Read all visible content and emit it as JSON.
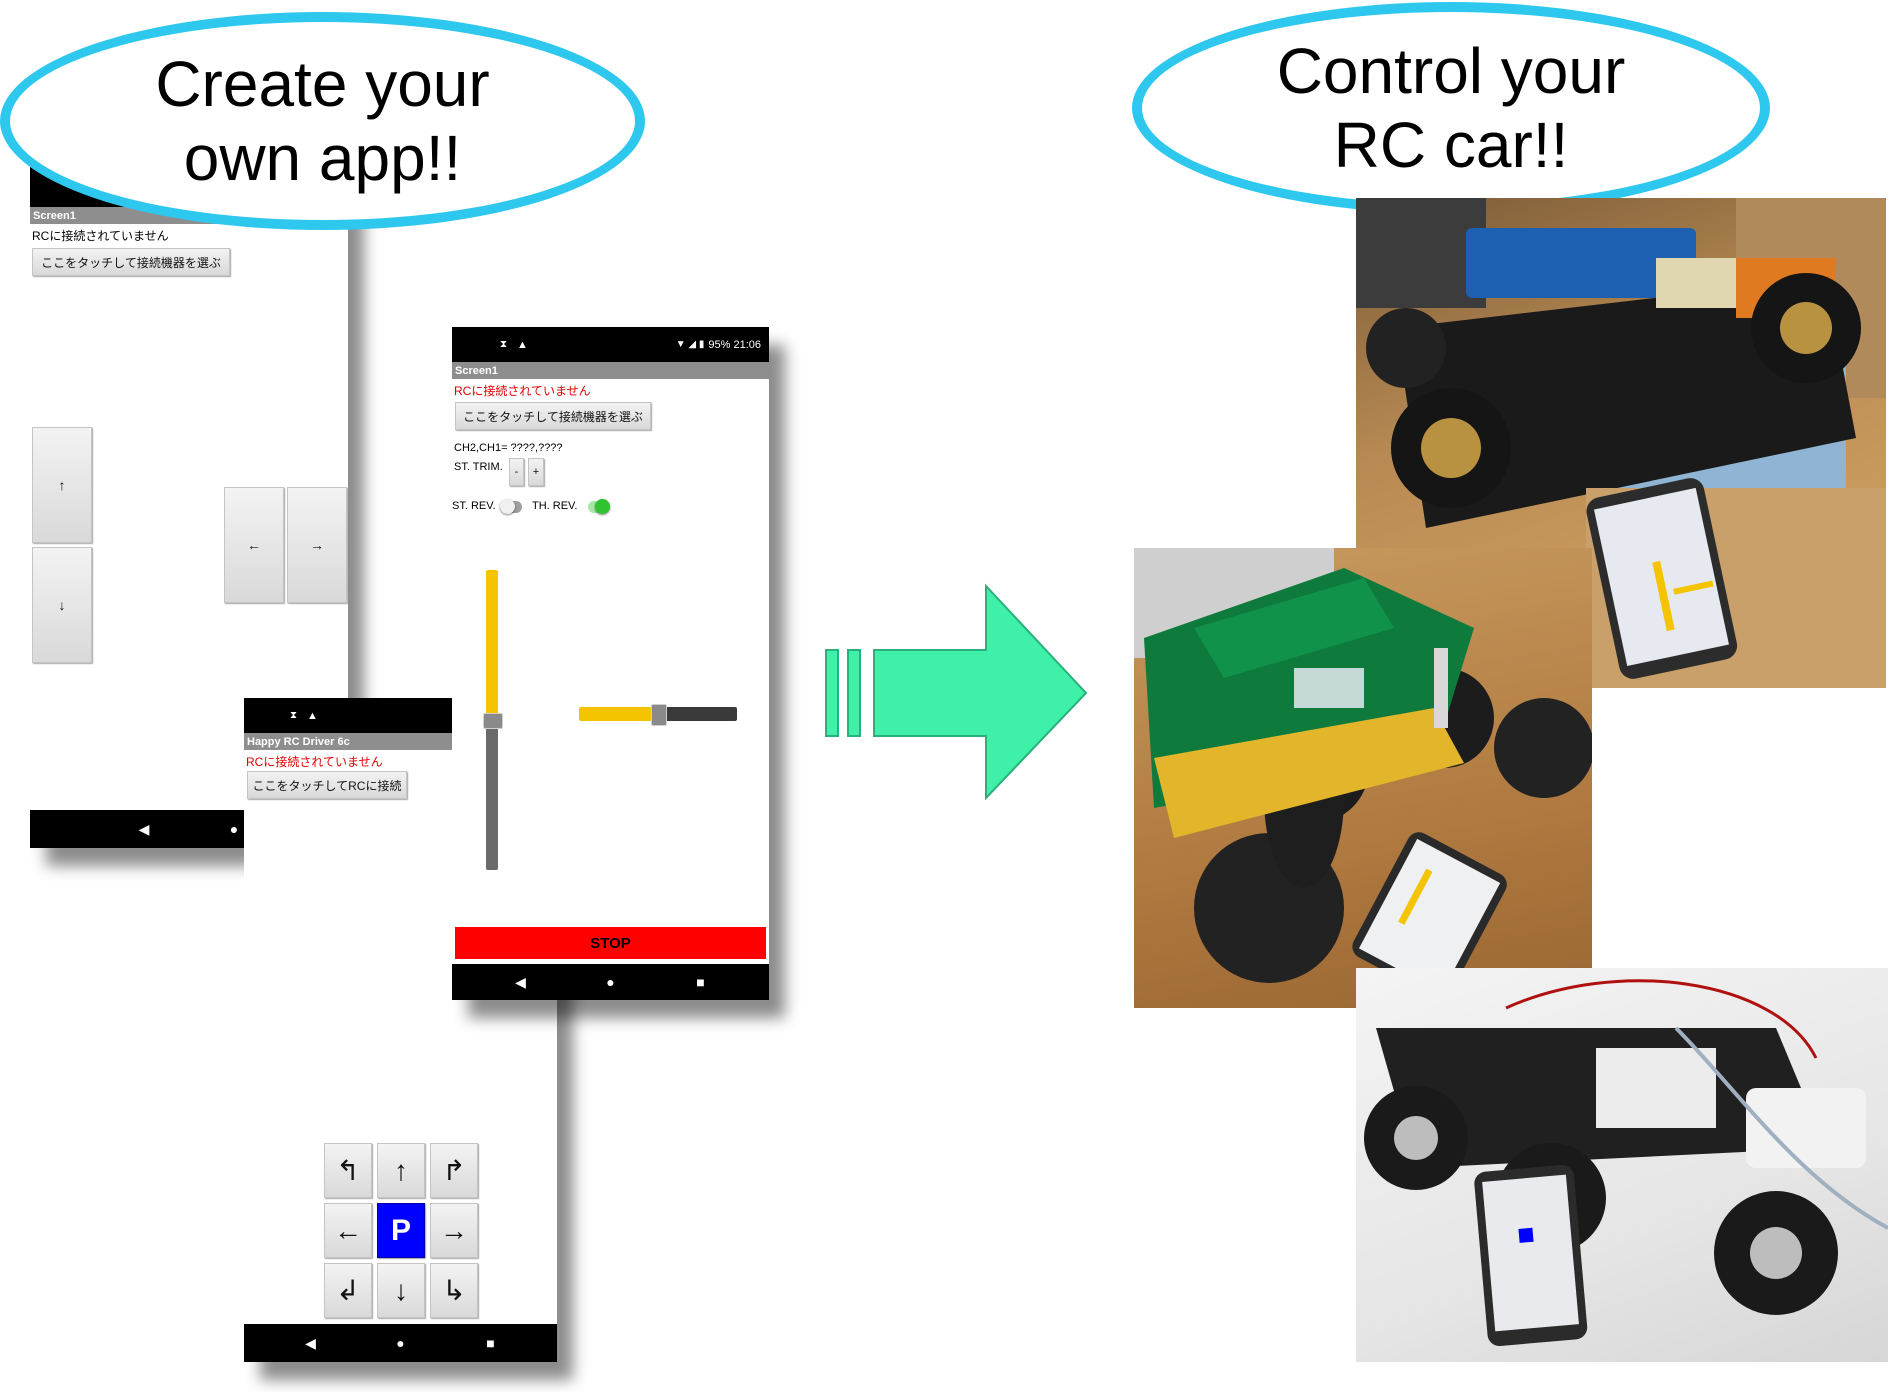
{
  "callout_left": {
    "line1": "Create your",
    "line2": "own app!!"
  },
  "callout_right": {
    "line1": "Control your",
    "line2": "RC car!!"
  },
  "phone_arrows": {
    "title": "Screen1",
    "status": "RCに接続されていません",
    "connect_button": "ここをタッチして接続機器を選ぶ",
    "up": "↑",
    "down": "↓",
    "left": "←",
    "right": "→",
    "nav_back": "◀",
    "nav_home": "●"
  },
  "phone_sliders": {
    "status_right": "95% 21:06",
    "title": "Screen1",
    "status": "RCに接続されていません",
    "connect_button": "ここをタッチして接続機器を選ぶ",
    "channels": "CH2,CH1= ????,????",
    "st_trim_label": "ST. TRIM.",
    "trim_minus": "-",
    "trim_plus": "+",
    "st_rev_label": "ST. REV.",
    "th_rev_label": "TH. REV.",
    "stop_button": "STOP",
    "nav_back": "◀",
    "nav_home": "●",
    "nav_recent": "■",
    "slider_color": "#f5c400",
    "stop_color": "#ff0000"
  },
  "phone_dpad": {
    "title": "Happy RC Driver 6c",
    "status": "RCに接続されていません",
    "connect_button": "ここをタッチしてRCに接続",
    "dpad": [
      "↰",
      "↑",
      "↱",
      "←",
      "P",
      "→",
      "↲",
      "↓",
      "↳"
    ],
    "nav_back": "◀",
    "nav_home": "●",
    "nav_recent": "■",
    "park_color": "#0000ff"
  },
  "arrow_color": "#3ef0a8",
  "photos": [
    {
      "icon": "rc-car-chassis-photo"
    },
    {
      "icon": "green-monster-truck-photo"
    },
    {
      "icon": "rock-crawler-photo"
    }
  ]
}
